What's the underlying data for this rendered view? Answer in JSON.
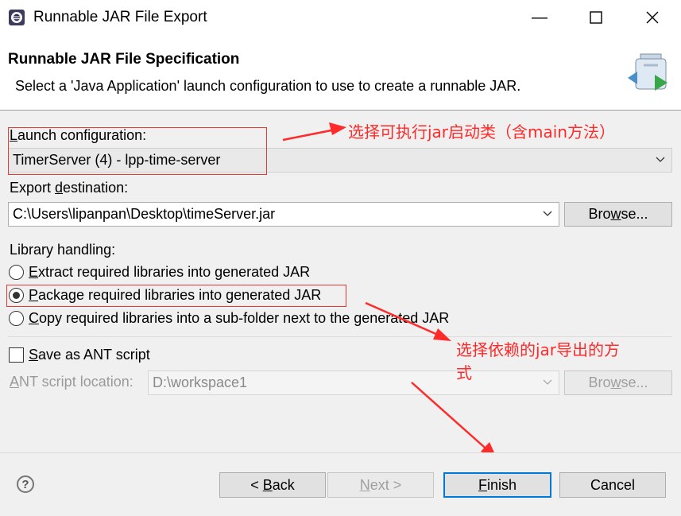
{
  "window": {
    "title": "Runnable JAR File Export",
    "minimize_glyph": "—",
    "maximize_glyph": "☐",
    "close_glyph": "✕"
  },
  "header": {
    "title": "Runnable JAR File Specification",
    "description": "Select a 'Java Application' launch configuration to use to create a runnable JAR."
  },
  "launch": {
    "label_mnemonic": "L",
    "label_rest": "aunch configuration:",
    "value": "TimerServer (4) - lpp-time-server"
  },
  "export": {
    "label_pre": "Export ",
    "label_mnemonic": "d",
    "label_rest": "estination:",
    "value": "C:\\Users\\lipanpan\\Desktop\\timeServer.jar",
    "browse_mnemonic": "w",
    "browse_pre": "Bro",
    "browse_rest": "se..."
  },
  "library": {
    "label": "Library handling:",
    "options": [
      {
        "mnemonic": "E",
        "rest": "xtract required libraries into generated JAR",
        "checked": false
      },
      {
        "mnemonic": "P",
        "rest": "ackage required libraries into generated JAR",
        "checked": true
      },
      {
        "mnemonic": "C",
        "rest": "opy required libraries into a sub-folder next to the generated JAR",
        "checked": false
      }
    ]
  },
  "ant": {
    "checkbox_mnemonic": "S",
    "checkbox_rest": "ave as ANT script",
    "location_mnemonic": "A",
    "location_rest": "NT script location:",
    "location_value": "D:\\workspace1",
    "browse_pre": "Bro",
    "browse_mnemonic": "w",
    "browse_rest": "se..."
  },
  "annotations": {
    "note1": "选择可执行jar启动类（含main方法）",
    "note2_line1": "选择依赖的jar导出的方",
    "note2_line2": "式",
    "color": "#ff2a2a"
  },
  "footer": {
    "help_glyph": "?",
    "back_pre": "< ",
    "back_mnemonic": "B",
    "back_rest": "ack",
    "next_mnemonic": "N",
    "next_rest": "ext >",
    "finish_mnemonic": "F",
    "finish_rest": "inish",
    "cancel": "Cancel"
  }
}
